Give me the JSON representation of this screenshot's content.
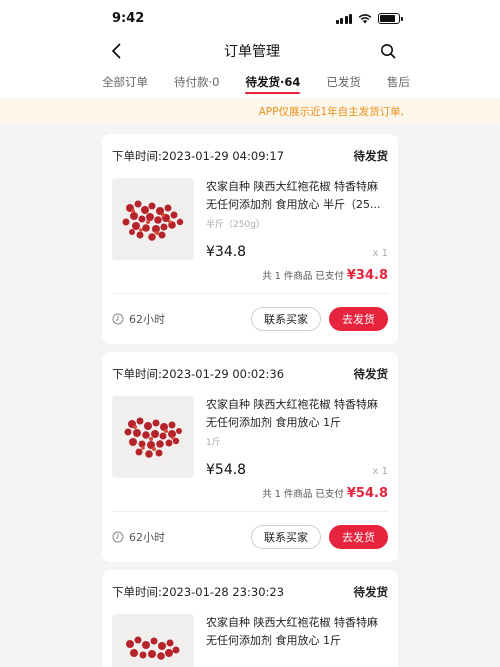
{
  "status_bar": {
    "time": "9:42"
  },
  "nav": {
    "title": "订单管理"
  },
  "tabs": [
    {
      "label": "全部订单"
    },
    {
      "label": "待付款·0"
    },
    {
      "label": "待发货·64"
    },
    {
      "label": "已发货"
    },
    {
      "label": "售后"
    }
  ],
  "notice": "APP仅展示近1年自主发货订单,",
  "orders": [
    {
      "time_label": "下单时间:",
      "time": "2023-01-29 04:09:17",
      "status": "待发货",
      "title": "农家自种 陕西大红袍花椒 特香特麻 无任何添加剂 食用放心 半斤（25...",
      "spec": "半斤（250g）",
      "price": "¥34.8",
      "qty": "x 1",
      "summary_text": "共 1 件商品  已支付",
      "paid": "¥34.8",
      "timer": "62小时",
      "contact_label": "联系买家",
      "ship_label": "去发货"
    },
    {
      "time_label": "下单时间:",
      "time": "2023-01-29 00:02:36",
      "status": "待发货",
      "title": "农家自种 陕西大红袍花椒 特香特麻 无任何添加剂 食用放心 1斤",
      "spec": "1斤",
      "price": "¥54.8",
      "qty": "x 1",
      "summary_text": "共 1 件商品  已支付",
      "paid": "¥54.8",
      "timer": "62小时",
      "contact_label": "联系买家",
      "ship_label": "去发货"
    },
    {
      "time_label": "下单时间:",
      "time": "2023-01-28 23:30:23",
      "status": "待发货",
      "title": "农家自种 陕西大红袍花椒 特香特麻 无任何添加剂 食用放心 1斤"
    }
  ],
  "colors": {
    "accent": "#e6243d",
    "notice_bg": "#fdf6ea",
    "notice_text": "#e8911e"
  },
  "icons": {
    "back": "chevron-left-icon",
    "search": "search-icon",
    "timer": "clock-icon"
  }
}
